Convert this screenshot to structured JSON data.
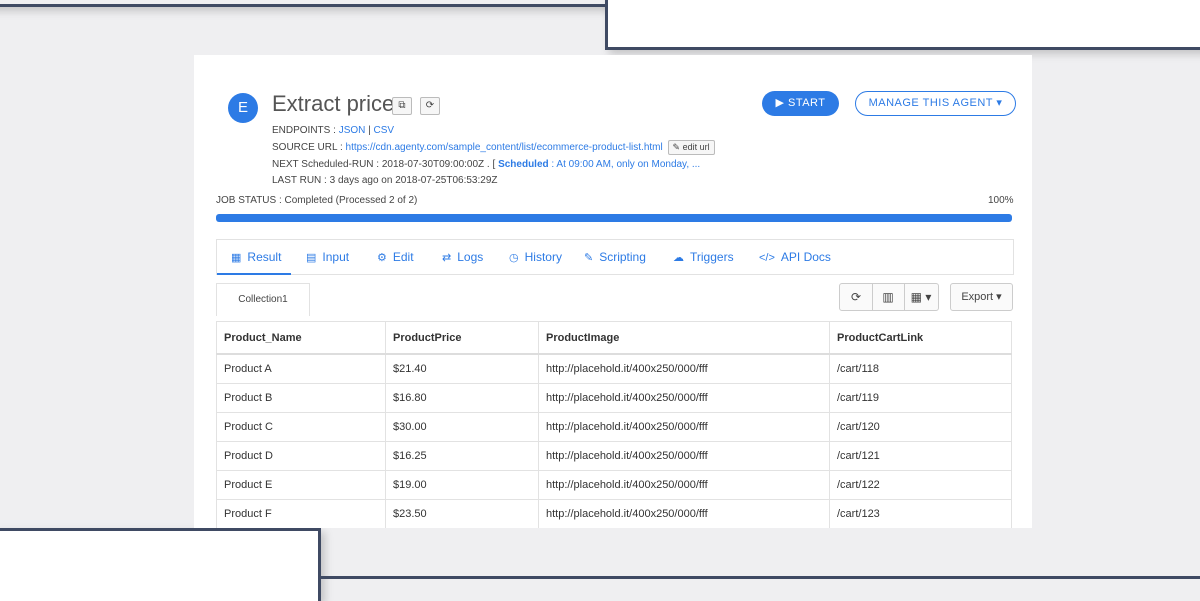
{
  "agent": {
    "avatar_letter": "E",
    "title": "Extract price",
    "endpoints_label": "ENDPOINTS :",
    "endpoint_json": "JSON",
    "endpoint_sep": "|",
    "endpoint_csv": "CSV",
    "source_label": "SOURCE URL :",
    "source_url": "https://cdn.agenty.com/sample_content/list/ecommerce-product-list.html",
    "edit_url_label": "edit url",
    "next_run_label": "NEXT Scheduled-RUN : 2018-07-30T09:00:00Z . [",
    "scheduled_label": "Scheduled",
    "scheduled_text": ": At 09:00 AM, only on Monday, ...",
    "last_run": "LAST RUN : 3 days ago on 2018-07-25T06:53:29Z"
  },
  "actions": {
    "start_label": "▶ START",
    "manage_label": "MANAGE THIS AGENT ▾"
  },
  "job": {
    "status": "JOB STATUS : Completed (Processed 2 of 2)",
    "percent_label": "100%",
    "progress": 1.0
  },
  "tabs": [
    {
      "icon": "▦",
      "label": "Result"
    },
    {
      "icon": "▤",
      "label": "Input"
    },
    {
      "icon": "⚙",
      "label": "Edit"
    },
    {
      "icon": "⇄",
      "label": "Logs"
    },
    {
      "icon": "◷",
      "label": "History"
    },
    {
      "icon": "✎",
      "label": "Scripting"
    },
    {
      "icon": "☁",
      "label": "Triggers"
    },
    {
      "icon": "</>",
      "label": "API Docs"
    }
  ],
  "collection_tab": "Collection1",
  "toolbar": {
    "refresh_icon": "⟳",
    "columns_icon": "▥",
    "grid_icon": "▦ ▾",
    "export_label": "Export ▾"
  },
  "table": {
    "headers": [
      "Product_Name",
      "ProductPrice",
      "ProductImage",
      "ProductCartLink"
    ],
    "rows": [
      [
        "Product A",
        "$21.40",
        "http://placehold.it/400x250/000/fff",
        "/cart/118"
      ],
      [
        "Product B",
        "$16.80",
        "http://placehold.it/400x250/000/fff",
        "/cart/119"
      ],
      [
        "Product C",
        "$30.00",
        "http://placehold.it/400x250/000/fff",
        "/cart/120"
      ],
      [
        "Product D",
        "$16.25",
        "http://placehold.it/400x250/000/fff",
        "/cart/121"
      ],
      [
        "Product E",
        "$19.00",
        "http://placehold.it/400x250/000/fff",
        "/cart/122"
      ],
      [
        "Product F",
        "$23.50",
        "http://placehold.it/400x250/000/fff",
        "/cart/123"
      ]
    ]
  },
  "colors": {
    "accent": "#2d7be5",
    "frame": "#3f4a63"
  }
}
